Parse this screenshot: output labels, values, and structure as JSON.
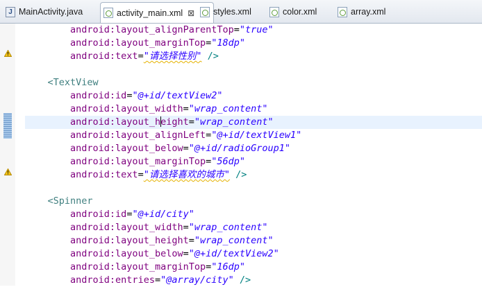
{
  "tabs": [
    {
      "label": "MainActivity.java",
      "icon": "java-file-icon",
      "active": false
    },
    {
      "label": "activity_main.xml",
      "icon": "xml-file-icon",
      "active": true,
      "close": "⊠"
    },
    {
      "label": "styles.xml",
      "icon": "xml-file-icon",
      "active": false
    },
    {
      "label": "color.xml",
      "icon": "xml-file-icon",
      "active": false
    },
    {
      "label": "array.xml",
      "icon": "xml-file-icon",
      "active": false
    }
  ],
  "code": {
    "l1": {
      "attr": "android:layout_alignParentTop",
      "val": "\"true\""
    },
    "l2": {
      "attr": "android:layout_marginTop",
      "val": "\"18dp\""
    },
    "l3": {
      "attr": "android:text",
      "val": "\"请选择性别\"",
      "end": " />"
    },
    "l5": {
      "tag": "<TextView"
    },
    "l6": {
      "attr": "android:id",
      "val": "\"@+id/textView2\""
    },
    "l7": {
      "attr": "android:layout_width",
      "val": "\"wrap_content\""
    },
    "l8": {
      "attr_a": "android:layout_h",
      "attr_b": "eight",
      "val": "\"wrap_content\""
    },
    "l9": {
      "attr": "android:layout_alignLeft",
      "val": "\"@+id/textView1\""
    },
    "l10": {
      "attr": "android:layout_below",
      "val": "\"@+id/radioGroup1\""
    },
    "l11": {
      "attr": "android:layout_marginTop",
      "val": "\"56dp\""
    },
    "l12": {
      "attr": "android:text",
      "val": "\"请选择喜欢的城市\"",
      "end": " />"
    },
    "l14": {
      "tag": "<Spinner"
    },
    "l15": {
      "attr": "android:id",
      "val": "\"@+id/city\""
    },
    "l16": {
      "attr": "android:layout_width",
      "val": "\"wrap_content\""
    },
    "l17": {
      "attr": "android:layout_height",
      "val": "\"wrap_content\""
    },
    "l18": {
      "attr": "android:layout_below",
      "val": "\"@+id/textView2\""
    },
    "l19": {
      "attr": "android:layout_marginTop",
      "val": "\"16dp\""
    },
    "l20": {
      "attr": "android:entries",
      "val": "\"@array/city\"",
      "end": " />"
    }
  },
  "equals": "="
}
